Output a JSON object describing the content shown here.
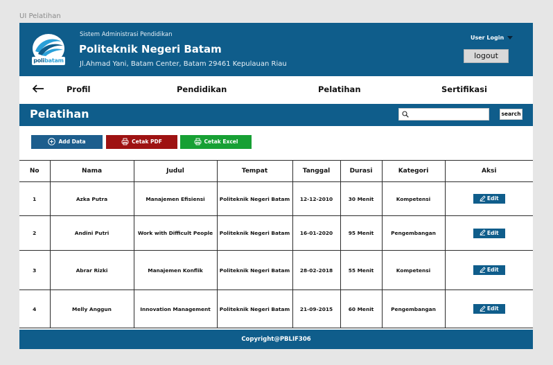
{
  "frame": {
    "title": "UI Pelatihan"
  },
  "header": {
    "logo_text_1": "poli",
    "logo_text_2": "batam",
    "system_name": "Sistem Administrasi Pendidikan",
    "institution": "Politeknik Negeri Batam",
    "address": "Jl.Ahmad Yani, Batam Center, Batam 29461 Kepulauan Riau",
    "user_login": "User Login",
    "logout": "logout"
  },
  "nav": {
    "items": [
      "Profil",
      "Pendidikan",
      "Pelatihan",
      "Sertifikasi"
    ]
  },
  "section": {
    "title": "Pelatihan",
    "search_placeholder": "",
    "search_button": "search"
  },
  "actions": {
    "add": "Add Data",
    "pdf": "Cetak PDF",
    "excel": "Cetak Excel"
  },
  "table": {
    "columns": [
      "No",
      "Nama",
      "Judul",
      "Tempat",
      "Tanggal",
      "Durasi",
      "Kategori",
      "Aksi"
    ],
    "rows": [
      {
        "no": "1",
        "nama": "Azka Putra",
        "judul": "Manajemen Efisiensi",
        "tempat": "Politeknik Negeri Batam",
        "tanggal": "12-12-2010",
        "durasi": "30 Menit",
        "kategori": "Kompetensi",
        "aksi": "Edit"
      },
      {
        "no": "2",
        "nama": "Andini Putri",
        "judul": "Work with Difficult People",
        "tempat": "Politeknik Negeri Batam",
        "tanggal": "16-01-2020",
        "durasi": "95 Menit",
        "kategori": "Pengembangan",
        "aksi": "Edit"
      },
      {
        "no": "3",
        "nama": "Abrar Rizki",
        "judul": "Manajemen Konflik",
        "tempat": "Politeknik Negeri Batam",
        "tanggal": "28-02-2018",
        "durasi": "55 Menit",
        "kategori": "Kompetensi",
        "aksi": "Edit"
      },
      {
        "no": "4",
        "nama": "Melly Anggun",
        "judul": "Innovation Management",
        "tempat": "Politeknik Negeri Batam",
        "tanggal": "21-09-2015",
        "durasi": "60 Menit",
        "kategori": "Pengembangan",
        "aksi": "Edit"
      }
    ]
  },
  "footer": {
    "copyright": "Copyright@PBLIF306"
  },
  "colors": {
    "primary": "#0f5d8b",
    "add_button": "#1d5e8d",
    "pdf_button": "#9e1212",
    "excel_button": "#17a034",
    "canvas": "#e6e6e6"
  },
  "icons": {
    "back": "arrow-left-icon",
    "search": "search-icon",
    "add": "plus-circle-icon",
    "print": "printer-icon",
    "edit": "pencil-icon",
    "dropdown": "caret-down-icon"
  }
}
